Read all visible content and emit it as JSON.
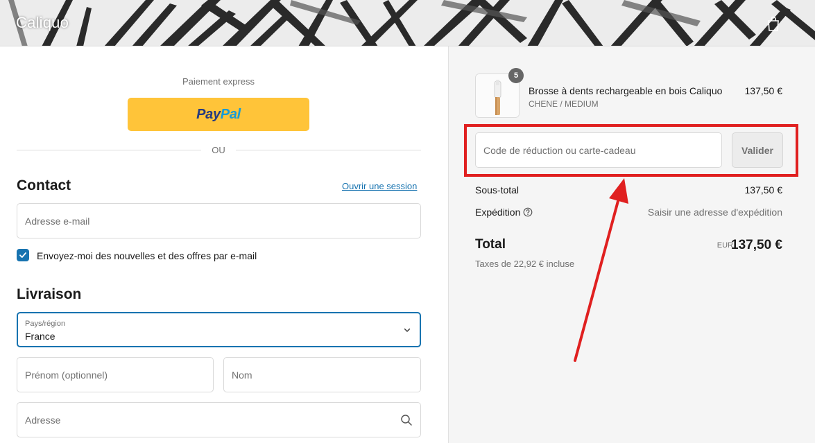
{
  "header": {
    "brand": "Caliquo",
    "cart_icon": "shopping-bag-icon"
  },
  "express": {
    "label": "Paiement express",
    "paypal_part1": "Pay",
    "paypal_part2": "Pal",
    "divider": "OU"
  },
  "contact": {
    "title": "Contact",
    "login_link": "Ouvrir une session",
    "email_placeholder": "Adresse e-mail",
    "newsletter_label": "Envoyez-moi des nouvelles et des offres par e-mail",
    "newsletter_checked": true
  },
  "shipping": {
    "title": "Livraison",
    "country_label": "Pays/région",
    "country_value": "France",
    "firstname_placeholder": "Prénom (optionnel)",
    "lastname_placeholder": "Nom",
    "address_placeholder": "Adresse"
  },
  "order": {
    "product_name": "Brosse à dents rechargeable en bois Caliquo",
    "product_variant": "CHENE / MEDIUM",
    "product_price": "137,50 €",
    "quantity": "5",
    "discount_placeholder": "Code de réduction ou carte-cadeau",
    "validate_label": "Valider",
    "subtotal_label": "Sous-total",
    "subtotal_value": "137,50 €",
    "shipping_label": "Expédition",
    "shipping_value": "Saisir une adresse d'expédition",
    "total_label": "Total",
    "currency": "EUR",
    "total_value": "137,50 €",
    "tax_note": "Taxes de 22,92 € incluse"
  },
  "colors": {
    "accent": "#1773b0",
    "paypal_yellow": "#ffc439",
    "highlight_red": "#e02020"
  }
}
